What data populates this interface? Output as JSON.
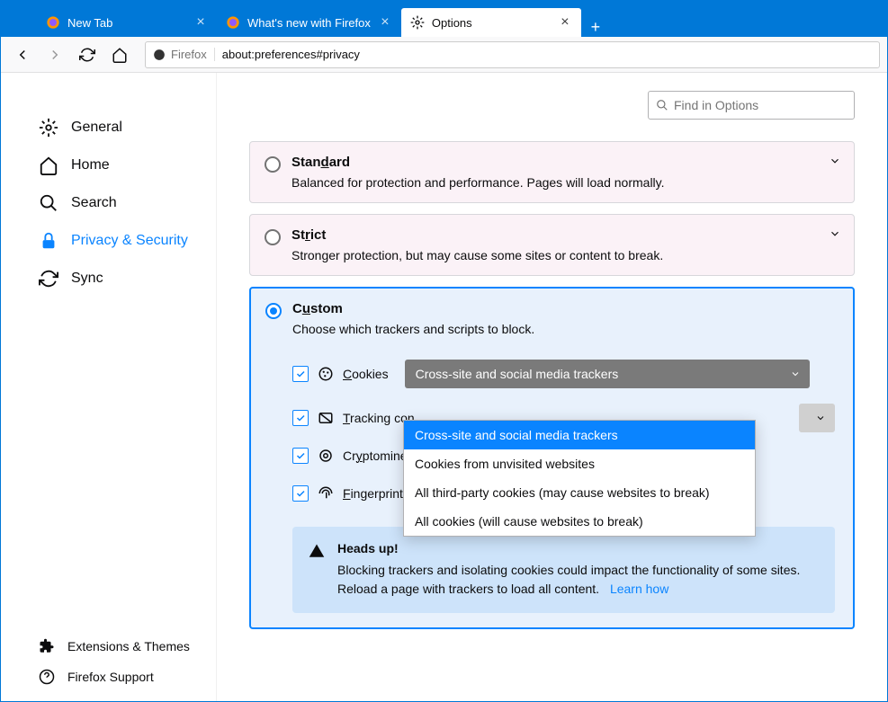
{
  "tabs": [
    {
      "label": "New Tab",
      "active": false
    },
    {
      "label": "What's new with Firefox",
      "active": false
    },
    {
      "label": "Options",
      "active": true
    }
  ],
  "urlbar": {
    "identity": "Firefox",
    "url": "about:preferences#privacy"
  },
  "search": {
    "placeholder": "Find in Options"
  },
  "sidebar": {
    "general": "General",
    "home": "Home",
    "search": "Search",
    "privacy": "Privacy & Security",
    "sync": "Sync",
    "extensions": "Extensions & Themes",
    "support": "Firefox Support"
  },
  "panels": {
    "standard": {
      "title": "Standard",
      "desc": "Balanced for protection and performance. Pages will load normally."
    },
    "strict": {
      "title": "Strict",
      "desc": "Stronger protection, but may cause some sites or content to break."
    },
    "custom": {
      "title": "Custom",
      "desc": "Choose which trackers and scripts to block.",
      "cookies": "Cookies",
      "tracking": "Tracking con",
      "cryptominers": "Cryptominer",
      "fingerprinters": "Fingerprinters",
      "cookies_select": "Cross-site and social media trackers",
      "dropdown": [
        "Cross-site and social media trackers",
        "Cookies from unvisited websites",
        "All third-party cookies (may cause websites to break)",
        "All cookies (will cause websites to break)"
      ]
    }
  },
  "headsup": {
    "title": "Heads up!",
    "text": "Blocking trackers and isolating cookies could impact the functionality of some sites. Reload a page with trackers to load all content.",
    "learn": "Learn how"
  }
}
